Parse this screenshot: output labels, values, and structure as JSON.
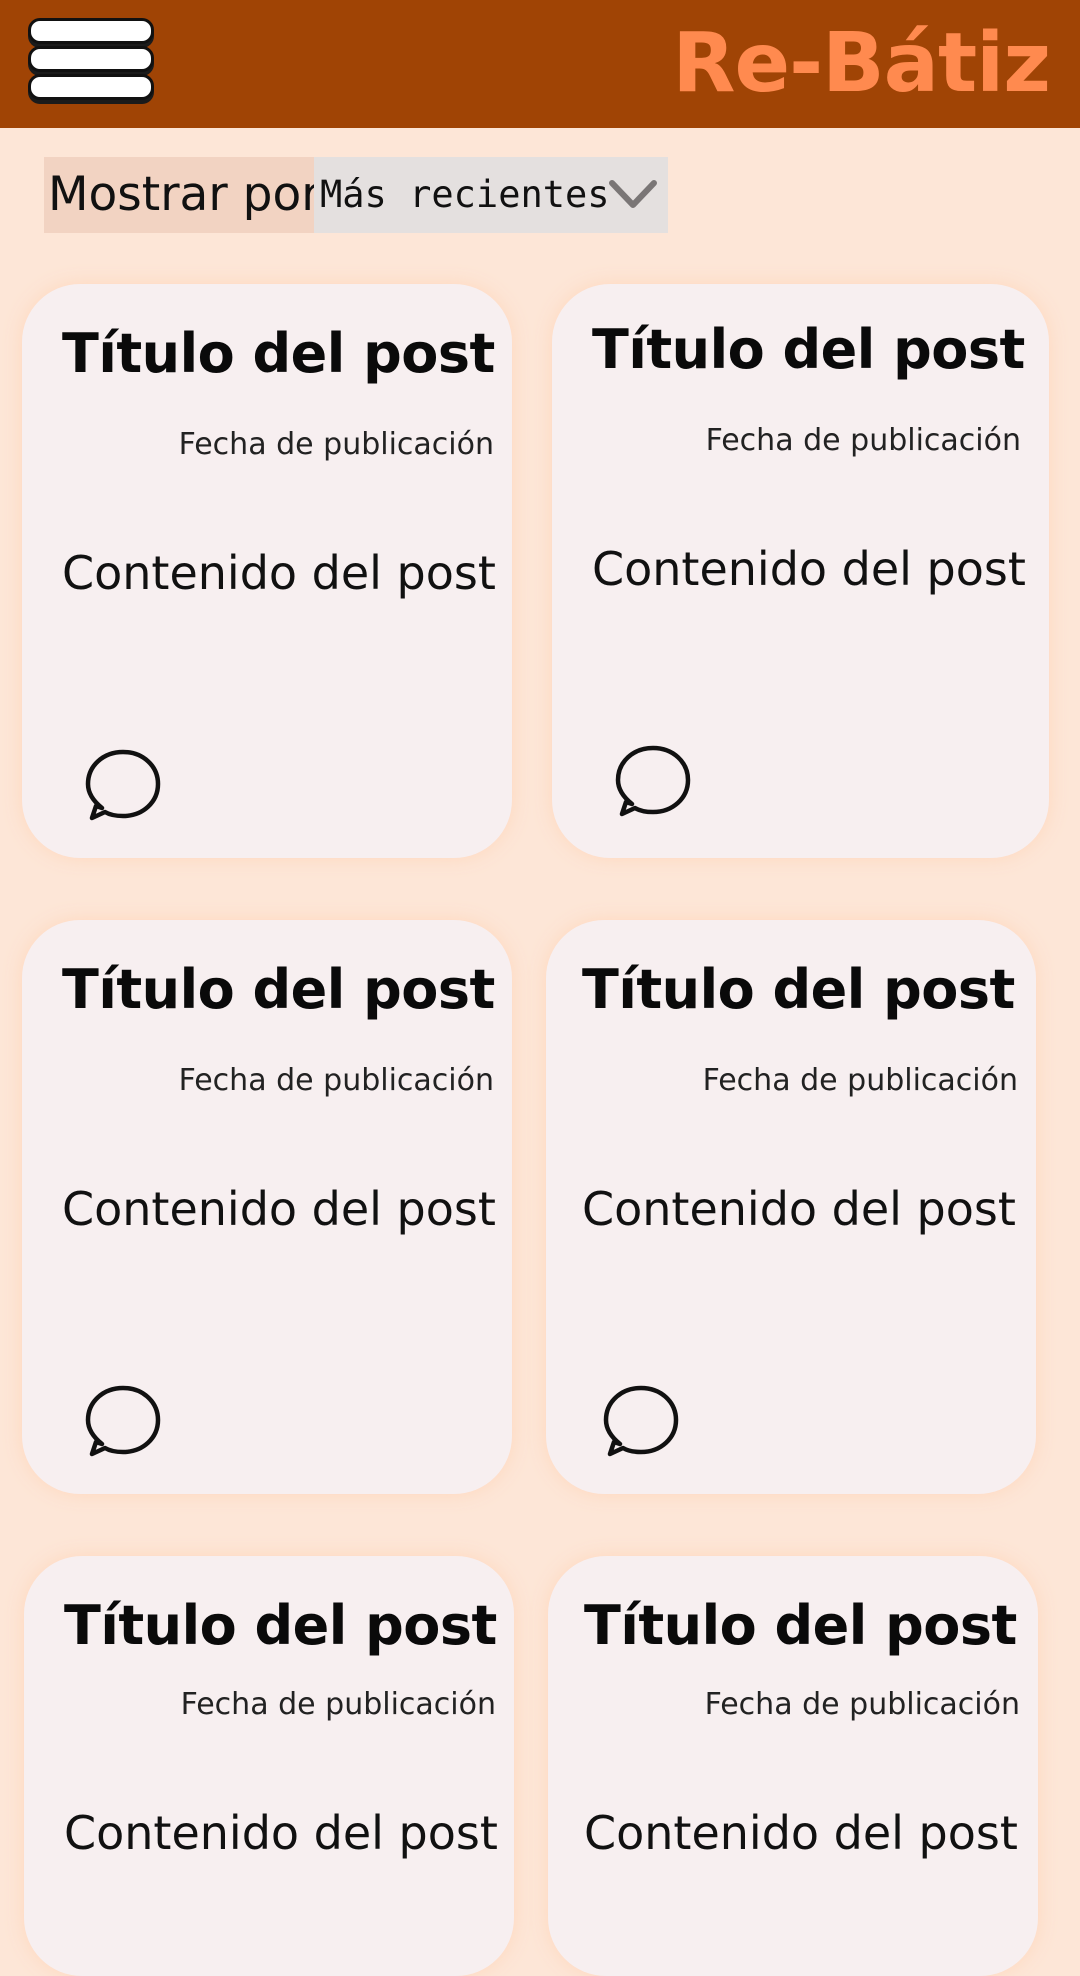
{
  "header": {
    "brand": "Re-Bátiz"
  },
  "sort": {
    "label": "Mostrar por",
    "selected": "Más recientes"
  },
  "posts": [
    {
      "title": "Título del post",
      "date": "Fecha de publicación",
      "content": "Contenido del post"
    },
    {
      "title": "Título del post",
      "date": "Fecha de publicación",
      "content": "Contenido del post"
    },
    {
      "title": "Título del post",
      "date": "Fecha de publicación",
      "content": "Contenido del post"
    },
    {
      "title": "Título del post",
      "date": "Fecha de publicación",
      "content": "Contenido del post"
    },
    {
      "title": "Título del post",
      "date": "Fecha de publicación",
      "content": "Contenido del post"
    },
    {
      "title": "Título del post",
      "date": "Fecha de publicación",
      "content": "Contenido del post"
    }
  ],
  "icons": {
    "menu": "hamburger-menu-icon",
    "dropdown": "chevron-down-icon",
    "comment": "speech-bubble-icon"
  },
  "colors": {
    "header_bg": "#a04405",
    "brand": "#ff8a4f",
    "page_bg": "#fde6d7",
    "card_bg": "#f7eff0"
  }
}
